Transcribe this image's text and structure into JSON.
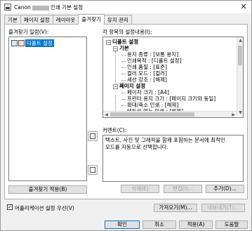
{
  "window": {
    "title_prefix": "Canon",
    "title_suffix": "인쇄 기본 설정",
    "close": "✕"
  },
  "tabs": [
    "기본",
    "페이지 설정",
    "레이아웃",
    "즐겨찾기",
    "유지 관리"
  ],
  "active_tab": 3,
  "favorites": {
    "label": "즐겨찾기 일람(V):",
    "items": [
      "디폴트 설정"
    ],
    "apply_button": "즐겨찾기 적용(B)"
  },
  "settings": {
    "label": "각 항목의 설정내용(I):",
    "tree": [
      {
        "text": "디폴트 설정",
        "level": 0,
        "expander": "−",
        "bold": true
      },
      {
        "text": "기본",
        "level": 1,
        "expander": "−",
        "bold": true
      },
      {
        "text": "용지 종류 : [보통 용지]",
        "level": 2
      },
      {
        "text": "인쇄목적 : [디폴트 설정]",
        "level": 2
      },
      {
        "text": "인쇄 품질 : [표준]",
        "level": 2
      },
      {
        "text": "컬러 모드 : [컬러]",
        "level": 2
      },
      {
        "text": "세선 강조 : [해제]",
        "level": 2
      },
      {
        "text": "페이지 설정",
        "level": 1,
        "expander": "−",
        "bold": true
      },
      {
        "text": "페이지 크기 : [A4]",
        "level": 2
      },
      {
        "text": "프린터 용지 크기 : [페이지 크기와 동일]",
        "level": 2
      },
      {
        "text": "확대/축소 인쇄 : [해제]",
        "level": 2
      },
      {
        "text": "테두리 없는 인쇄 : [해제]",
        "level": 2
      }
    ]
  },
  "comment": {
    "label": "커멘트(C):",
    "text": "텍스트, 사진 및 그래픽을 함께 포함하는 문서에 최적인 모드를 자동으로 선택합니다."
  },
  "buttons": {
    "delete": "삭제(E)",
    "edit": "편집(I)...",
    "add": "추가(D)...",
    "import": "가져오기(M)...",
    "export": "내보내기(T)...",
    "ok": "확인",
    "cancel": "취소",
    "apply": "적용(A)",
    "help": "도움말"
  },
  "app_setting": {
    "label": "어플리케이션 설정 우선(V)",
    "checked": true
  }
}
